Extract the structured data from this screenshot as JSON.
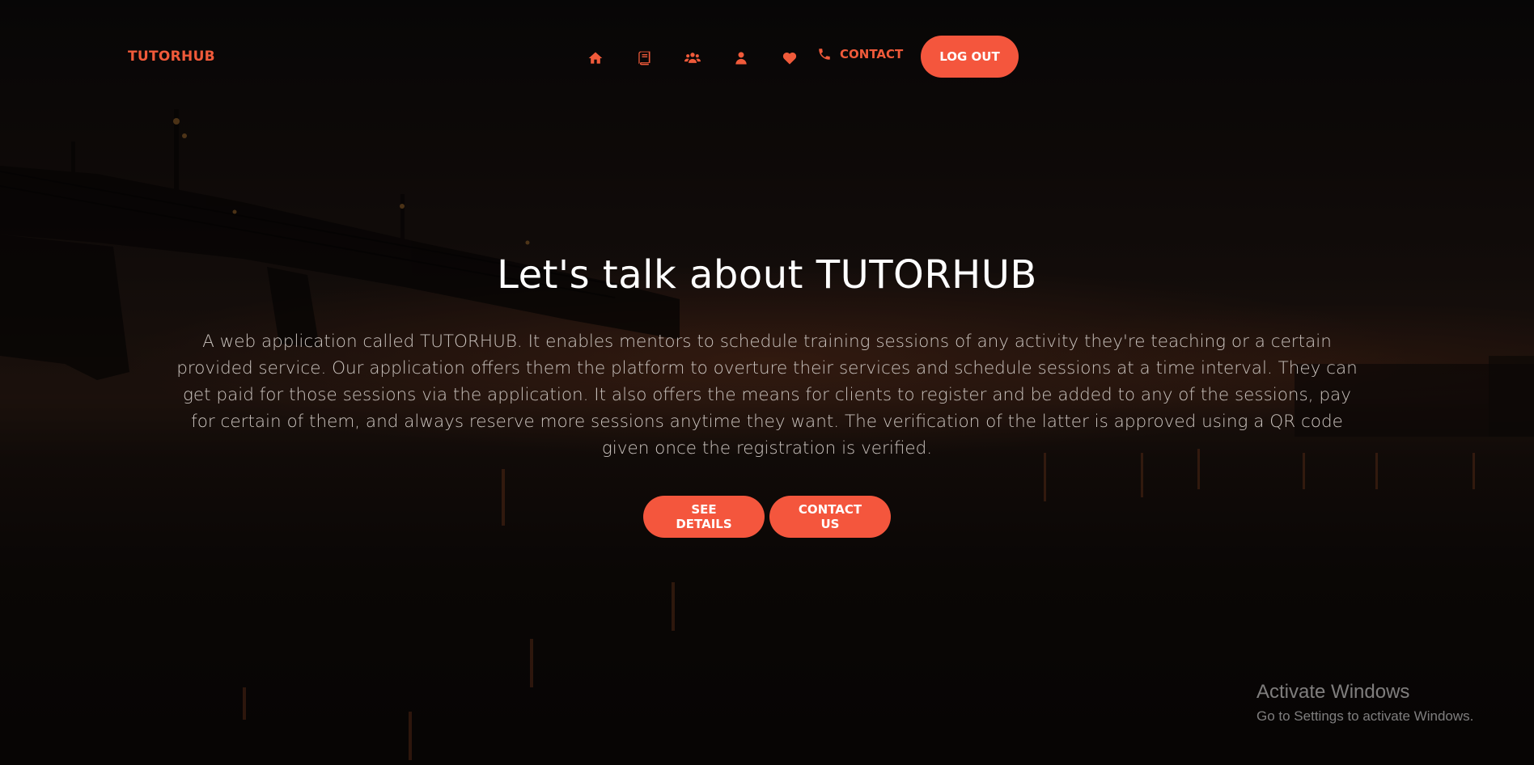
{
  "nav": {
    "brand": "TUTORHUB",
    "icons": [
      "home-icon",
      "book-icon",
      "users-icon",
      "user-icon",
      "heart-icon"
    ],
    "contact_label": "CONTACT",
    "contact_icon": "phone-icon",
    "logout_label": "LOG OUT"
  },
  "hero": {
    "title": "Let's talk about TUTORHUB",
    "description": "A web application called TUTORHUB. It enables mentors to schedule training sessions of any activity they're teaching or a certain provided service. Our application offers them the platform to overture their services and schedule sessions at a time interval. They can get paid for those sessions via the application. It also offers the means for clients to register and be added to any of the sessions, pay for certain of them, and always reserve more sessions anytime they want. The verification of the latter is approved using a QR code given once the registration is verified.",
    "buttons": {
      "details": "SEE DETAILS",
      "contact": "CONTACT US"
    }
  },
  "watermark": {
    "title": "Activate Windows",
    "subtitle": "Go to Settings to activate Windows."
  },
  "colors": {
    "accent": "#f4563d",
    "brand_text": "#f05a3a"
  }
}
